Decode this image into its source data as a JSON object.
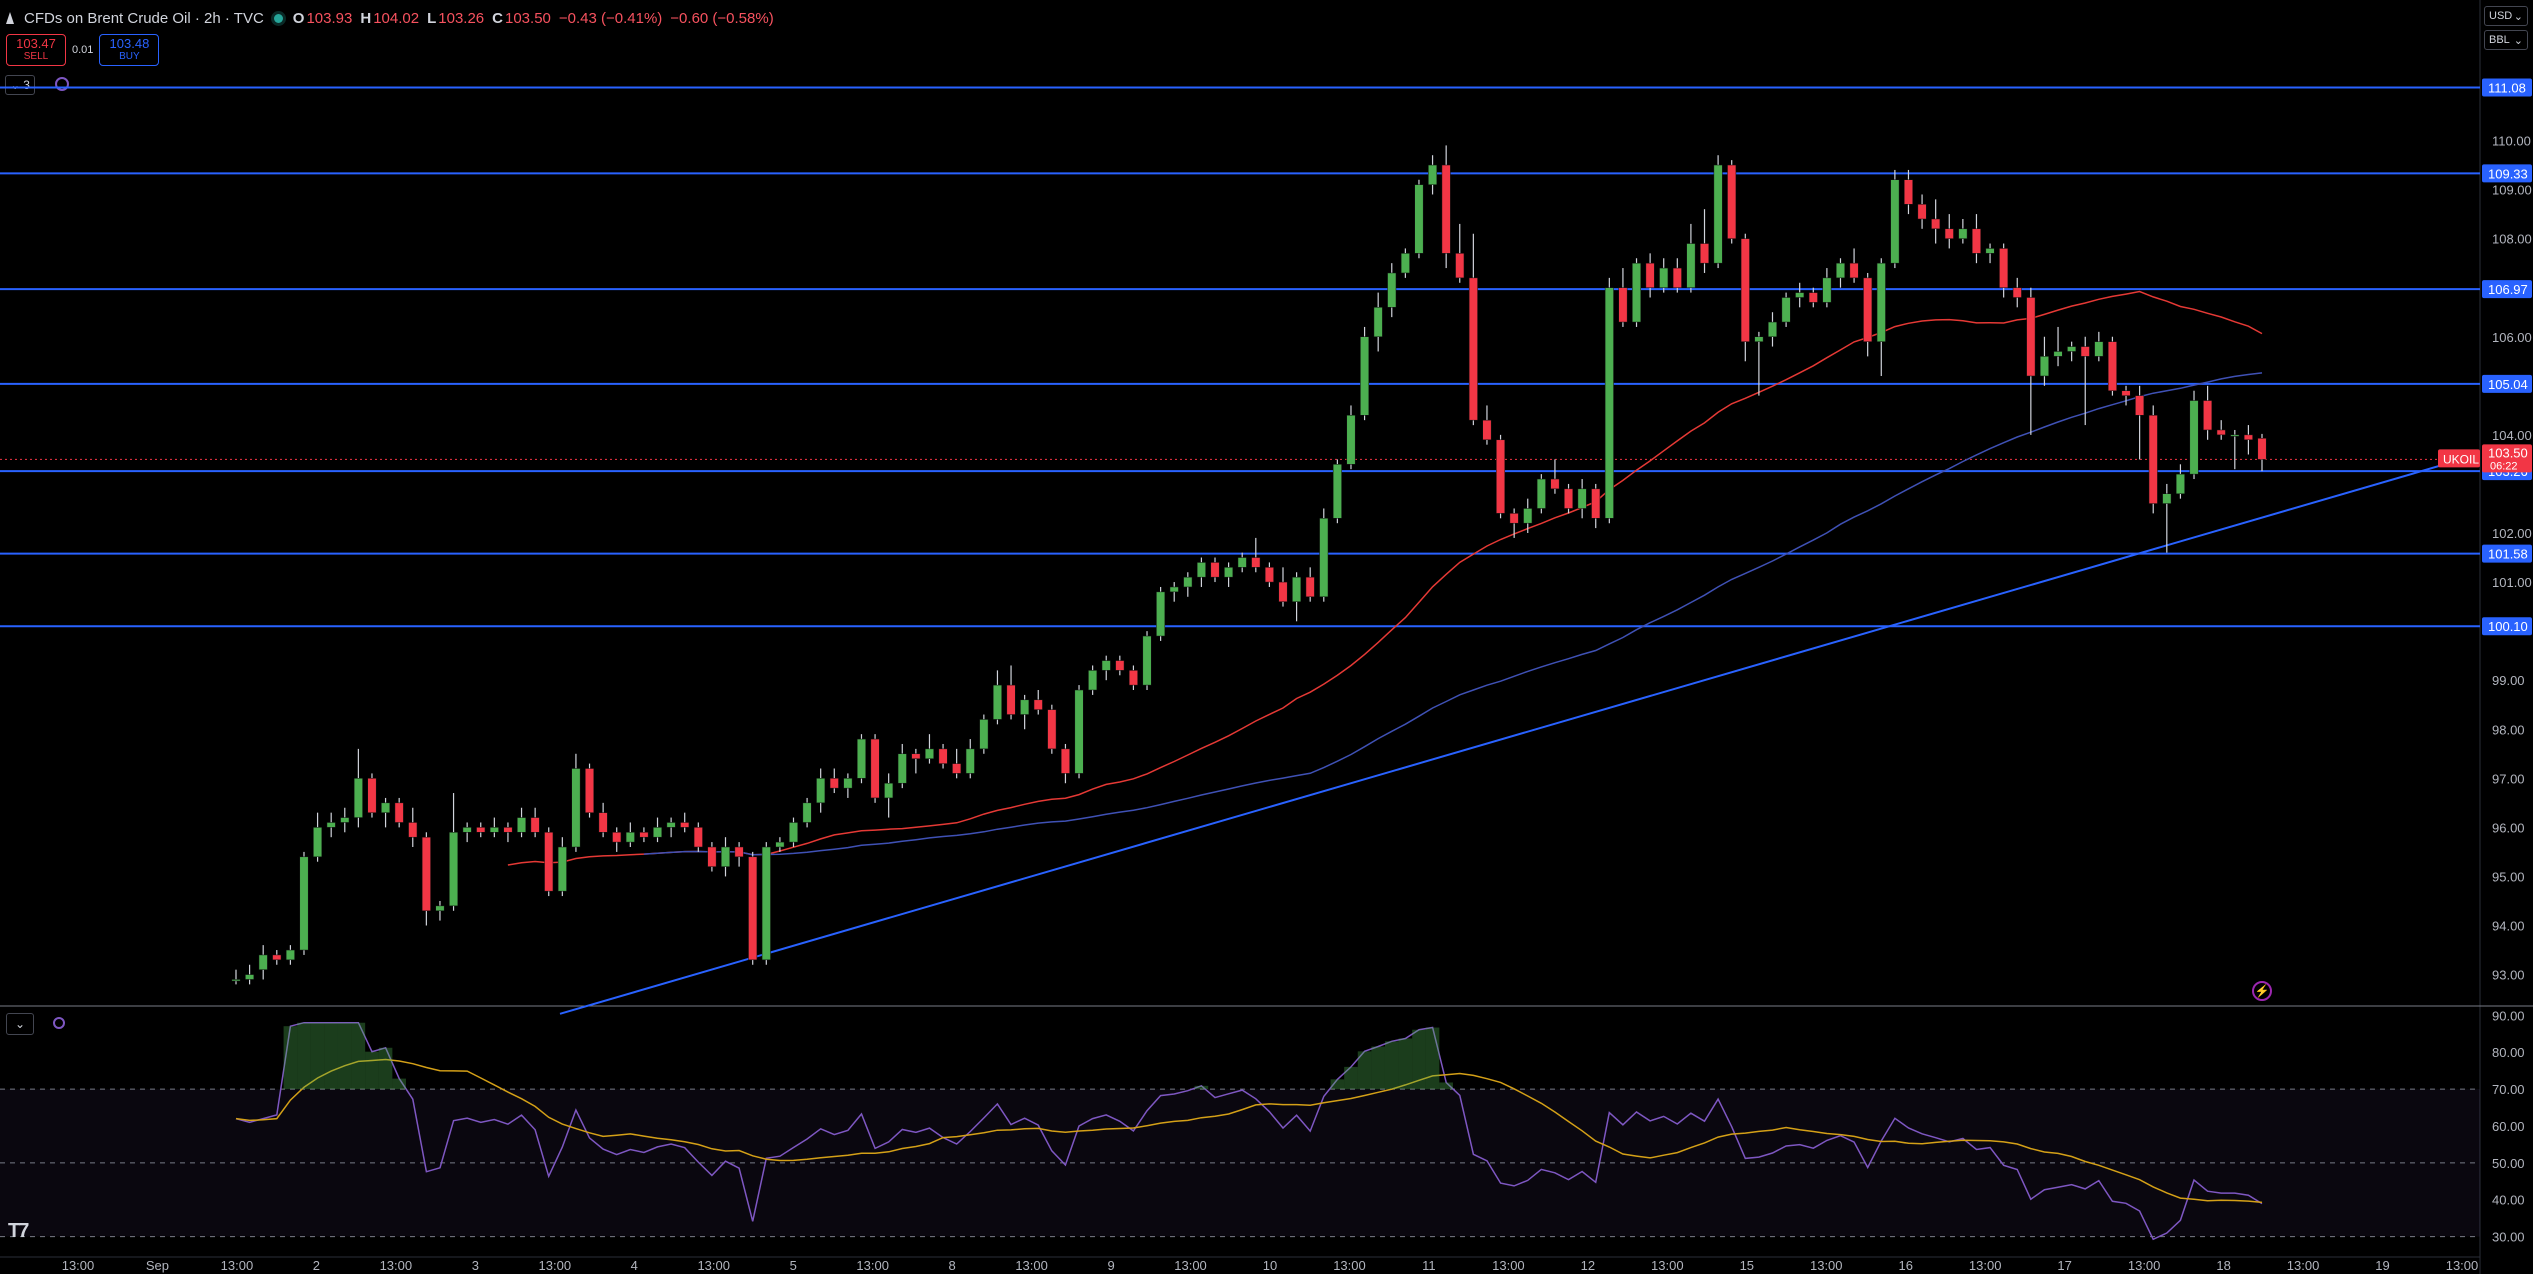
{
  "header": {
    "title": "CFDs on Brent Crude Oil · 2h · TVC",
    "ohlc": [
      {
        "key": "O",
        "value": "103.93"
      },
      {
        "key": "H",
        "value": "104.02"
      },
      {
        "key": "L",
        "value": "103.26"
      },
      {
        "key": "C",
        "value": "103.50"
      }
    ],
    "change": "−0.43 (−0.41%)",
    "change2": "−0.60 (−0.58%)"
  },
  "trade": {
    "sell_price": "103.47",
    "sell_label": "SELL",
    "spread": "0.01",
    "buy_price": "103.48",
    "buy_label": "BUY"
  },
  "indicators_count": "3",
  "units": {
    "currency": "USD",
    "unit": "BBL"
  },
  "colors": {
    "up": "#26a69a",
    "up_body": "#4caf50",
    "down": "#f23645",
    "hline": "#2962ff",
    "ma_red": "#e53935",
    "ma_blue": "#3f51b5",
    "rsi": "#7e57c2",
    "rsi_ma": "#d4a017"
  },
  "price_axis": {
    "ticks": [
      "110.00",
      "109.00",
      "108.00",
      "106.00",
      "104.00",
      "102.00",
      "101.00",
      "99.00",
      "98.00",
      "97.00",
      "96.00",
      "95.00",
      "94.00",
      "93.00"
    ],
    "level_labels": [
      "111.08",
      "109.33",
      "106.97",
      "105.04",
      "103.26",
      "101.58",
      "100.10"
    ],
    "symbol_tag": "UKOIL",
    "last_price": "103.50",
    "countdown": "06:22"
  },
  "rsi_axis": {
    "ticks": [
      "90.00",
      "80.00",
      "70.00",
      "60.00",
      "50.00",
      "40.00",
      "30.00"
    ]
  },
  "time_axis": {
    "labels": [
      "13:00",
      "Sep",
      "13:00",
      "2",
      "13:00",
      "3",
      "13:00",
      "4",
      "13:00",
      "5",
      "13:00",
      "8",
      "13:00",
      "9",
      "13:00",
      "10",
      "13:00",
      "11",
      "13:00",
      "12",
      "13:00",
      "15",
      "13:00",
      "16",
      "13:00",
      "17",
      "13:00",
      "18",
      "13:00",
      "19",
      "13:00"
    ]
  },
  "chart_data": {
    "type": "candlestick",
    "title": "CFDs on Brent Crude Oil · 2h · TVC",
    "ylim": [
      92.4,
      111.6
    ],
    "horizontal_levels": [
      111.08,
      109.33,
      106.97,
      105.04,
      103.26,
      101.58,
      100.1
    ],
    "candles": [
      {
        "o": 92.9,
        "h": 93.1,
        "l": 92.8,
        "c": 92.9
      },
      {
        "o": 92.9,
        "h": 93.2,
        "l": 92.8,
        "c": 93.0
      },
      {
        "o": 93.1,
        "h": 93.6,
        "l": 92.9,
        "c": 93.4
      },
      {
        "o": 93.4,
        "h": 93.5,
        "l": 93.2,
        "c": 93.3
      },
      {
        "o": 93.3,
        "h": 93.6,
        "l": 93.2,
        "c": 93.5
      },
      {
        "o": 93.5,
        "h": 95.5,
        "l": 93.4,
        "c": 95.4
      },
      {
        "o": 95.4,
        "h": 96.3,
        "l": 95.3,
        "c": 96.0
      },
      {
        "o": 96.0,
        "h": 96.3,
        "l": 95.8,
        "c": 96.1
      },
      {
        "o": 96.1,
        "h": 96.4,
        "l": 95.9,
        "c": 96.2
      },
      {
        "o": 96.2,
        "h": 97.6,
        "l": 96.0,
        "c": 97.0
      },
      {
        "o": 97.0,
        "h": 97.1,
        "l": 96.2,
        "c": 96.3
      },
      {
        "o": 96.3,
        "h": 96.6,
        "l": 96.0,
        "c": 96.5
      },
      {
        "o": 96.5,
        "h": 96.6,
        "l": 96.0,
        "c": 96.1
      },
      {
        "o": 96.1,
        "h": 96.4,
        "l": 95.6,
        "c": 95.8
      },
      {
        "o": 95.8,
        "h": 95.9,
        "l": 94.0,
        "c": 94.3
      },
      {
        "o": 94.3,
        "h": 94.5,
        "l": 94.1,
        "c": 94.4
      },
      {
        "o": 94.4,
        "h": 96.7,
        "l": 94.3,
        "c": 95.9
      },
      {
        "o": 95.9,
        "h": 96.1,
        "l": 95.7,
        "c": 96.0
      },
      {
        "o": 96.0,
        "h": 96.1,
        "l": 95.8,
        "c": 95.9
      },
      {
        "o": 95.9,
        "h": 96.2,
        "l": 95.8,
        "c": 96.0
      },
      {
        "o": 96.0,
        "h": 96.1,
        "l": 95.7,
        "c": 95.9
      },
      {
        "o": 95.9,
        "h": 96.4,
        "l": 95.8,
        "c": 96.2
      },
      {
        "o": 96.2,
        "h": 96.4,
        "l": 95.8,
        "c": 95.9
      },
      {
        "o": 95.9,
        "h": 96.0,
        "l": 94.6,
        "c": 94.7
      },
      {
        "o": 94.7,
        "h": 95.8,
        "l": 94.6,
        "c": 95.6
      },
      {
        "o": 95.6,
        "h": 97.5,
        "l": 95.5,
        "c": 97.2
      },
      {
        "o": 97.2,
        "h": 97.3,
        "l": 96.2,
        "c": 96.3
      },
      {
        "o": 96.3,
        "h": 96.5,
        "l": 95.8,
        "c": 95.9
      },
      {
        "o": 95.9,
        "h": 96.0,
        "l": 95.5,
        "c": 95.7
      },
      {
        "o": 95.7,
        "h": 96.1,
        "l": 95.6,
        "c": 95.9
      },
      {
        "o": 95.9,
        "h": 96.0,
        "l": 95.7,
        "c": 95.8
      },
      {
        "o": 95.8,
        "h": 96.2,
        "l": 95.7,
        "c": 96.0
      },
      {
        "o": 96.0,
        "h": 96.2,
        "l": 95.8,
        "c": 96.1
      },
      {
        "o": 96.1,
        "h": 96.3,
        "l": 95.9,
        "c": 96.0
      },
      {
        "o": 96.0,
        "h": 96.1,
        "l": 95.5,
        "c": 95.6
      },
      {
        "o": 95.6,
        "h": 95.7,
        "l": 95.1,
        "c": 95.2
      },
      {
        "o": 95.2,
        "h": 95.8,
        "l": 95.0,
        "c": 95.6
      },
      {
        "o": 95.6,
        "h": 95.7,
        "l": 95.2,
        "c": 95.4
      },
      {
        "o": 95.4,
        "h": 95.5,
        "l": 93.2,
        "c": 93.3
      },
      {
        "o": 93.3,
        "h": 95.7,
        "l": 93.2,
        "c": 95.6
      },
      {
        "o": 95.6,
        "h": 95.8,
        "l": 95.5,
        "c": 95.7
      },
      {
        "o": 95.7,
        "h": 96.2,
        "l": 95.6,
        "c": 96.1
      },
      {
        "o": 96.1,
        "h": 96.6,
        "l": 96.0,
        "c": 96.5
      },
      {
        "o": 96.5,
        "h": 97.2,
        "l": 96.3,
        "c": 97.0
      },
      {
        "o": 97.0,
        "h": 97.2,
        "l": 96.7,
        "c": 96.8
      },
      {
        "o": 96.8,
        "h": 97.1,
        "l": 96.6,
        "c": 97.0
      },
      {
        "o": 97.0,
        "h": 97.9,
        "l": 96.9,
        "c": 97.8
      },
      {
        "o": 97.8,
        "h": 97.9,
        "l": 96.5,
        "c": 96.6
      },
      {
        "o": 96.6,
        "h": 97.1,
        "l": 96.2,
        "c": 96.9
      },
      {
        "o": 96.9,
        "h": 97.7,
        "l": 96.8,
        "c": 97.5
      },
      {
        "o": 97.5,
        "h": 97.6,
        "l": 97.1,
        "c": 97.4
      },
      {
        "o": 97.4,
        "h": 97.9,
        "l": 97.3,
        "c": 97.6
      },
      {
        "o": 97.6,
        "h": 97.7,
        "l": 97.2,
        "c": 97.3
      },
      {
        "o": 97.3,
        "h": 97.6,
        "l": 97.0,
        "c": 97.1
      },
      {
        "o": 97.1,
        "h": 97.8,
        "l": 97.0,
        "c": 97.6
      },
      {
        "o": 97.6,
        "h": 98.3,
        "l": 97.5,
        "c": 98.2
      },
      {
        "o": 98.2,
        "h": 99.2,
        "l": 98.1,
        "c": 98.9
      },
      {
        "o": 98.9,
        "h": 99.3,
        "l": 98.2,
        "c": 98.3
      },
      {
        "o": 98.3,
        "h": 98.7,
        "l": 98.0,
        "c": 98.6
      },
      {
        "o": 98.6,
        "h": 98.8,
        "l": 98.3,
        "c": 98.4
      },
      {
        "o": 98.4,
        "h": 98.5,
        "l": 97.5,
        "c": 97.6
      },
      {
        "o": 97.6,
        "h": 97.7,
        "l": 96.9,
        "c": 97.1
      },
      {
        "o": 97.1,
        "h": 98.9,
        "l": 97.0,
        "c": 98.8
      },
      {
        "o": 98.8,
        "h": 99.3,
        "l": 98.7,
        "c": 99.2
      },
      {
        "o": 99.2,
        "h": 99.5,
        "l": 99.0,
        "c": 99.4
      },
      {
        "o": 99.4,
        "h": 99.5,
        "l": 99.1,
        "c": 99.2
      },
      {
        "o": 99.2,
        "h": 99.3,
        "l": 98.8,
        "c": 98.9
      },
      {
        "o": 98.9,
        "h": 100.0,
        "l": 98.8,
        "c": 99.9
      },
      {
        "o": 99.9,
        "h": 100.9,
        "l": 99.8,
        "c": 100.8
      },
      {
        "o": 100.8,
        "h": 101.0,
        "l": 100.6,
        "c": 100.9
      },
      {
        "o": 100.9,
        "h": 101.2,
        "l": 100.7,
        "c": 101.1
      },
      {
        "o": 101.1,
        "h": 101.5,
        "l": 100.9,
        "c": 101.4
      },
      {
        "o": 101.4,
        "h": 101.5,
        "l": 101.0,
        "c": 101.1
      },
      {
        "o": 101.1,
        "h": 101.4,
        "l": 100.9,
        "c": 101.3
      },
      {
        "o": 101.3,
        "h": 101.6,
        "l": 101.2,
        "c": 101.5
      },
      {
        "o": 101.5,
        "h": 101.9,
        "l": 101.2,
        "c": 101.3
      },
      {
        "o": 101.3,
        "h": 101.4,
        "l": 100.9,
        "c": 101.0
      },
      {
        "o": 101.0,
        "h": 101.3,
        "l": 100.5,
        "c": 100.6
      },
      {
        "o": 100.6,
        "h": 101.2,
        "l": 100.2,
        "c": 101.1
      },
      {
        "o": 101.1,
        "h": 101.3,
        "l": 100.6,
        "c": 100.7
      },
      {
        "o": 100.7,
        "h": 102.5,
        "l": 100.6,
        "c": 102.3
      },
      {
        "o": 102.3,
        "h": 103.5,
        "l": 102.2,
        "c": 103.4
      },
      {
        "o": 103.4,
        "h": 104.6,
        "l": 103.3,
        "c": 104.4
      },
      {
        "o": 104.4,
        "h": 106.2,
        "l": 104.3,
        "c": 106.0
      },
      {
        "o": 106.0,
        "h": 106.9,
        "l": 105.7,
        "c": 106.6
      },
      {
        "o": 106.6,
        "h": 107.5,
        "l": 106.4,
        "c": 107.3
      },
      {
        "o": 107.3,
        "h": 107.8,
        "l": 107.2,
        "c": 107.7
      },
      {
        "o": 107.7,
        "h": 109.2,
        "l": 107.6,
        "c": 109.1
      },
      {
        "o": 109.1,
        "h": 109.7,
        "l": 108.9,
        "c": 109.5
      },
      {
        "o": 109.5,
        "h": 109.9,
        "l": 107.4,
        "c": 107.7
      },
      {
        "o": 107.7,
        "h": 108.3,
        "l": 107.1,
        "c": 107.2
      },
      {
        "o": 107.2,
        "h": 108.1,
        "l": 104.2,
        "c": 104.3
      },
      {
        "o": 104.3,
        "h": 104.6,
        "l": 103.8,
        "c": 103.9
      },
      {
        "o": 103.9,
        "h": 104.0,
        "l": 102.3,
        "c": 102.4
      },
      {
        "o": 102.4,
        "h": 102.5,
        "l": 101.9,
        "c": 102.2
      },
      {
        "o": 102.2,
        "h": 102.7,
        "l": 102.0,
        "c": 102.5
      },
      {
        "o": 102.5,
        "h": 103.2,
        "l": 102.4,
        "c": 103.1
      },
      {
        "o": 103.1,
        "h": 103.5,
        "l": 102.8,
        "c": 102.9
      },
      {
        "o": 102.9,
        "h": 103.0,
        "l": 102.4,
        "c": 102.5
      },
      {
        "o": 102.5,
        "h": 103.1,
        "l": 102.3,
        "c": 102.9
      },
      {
        "o": 102.9,
        "h": 103.0,
        "l": 102.1,
        "c": 102.3
      },
      {
        "o": 102.3,
        "h": 107.2,
        "l": 102.2,
        "c": 107.0
      },
      {
        "o": 107.0,
        "h": 107.4,
        "l": 106.2,
        "c": 106.3
      },
      {
        "o": 106.3,
        "h": 107.6,
        "l": 106.2,
        "c": 107.5
      },
      {
        "o": 107.5,
        "h": 107.7,
        "l": 106.8,
        "c": 107.0
      },
      {
        "o": 107.0,
        "h": 107.6,
        "l": 106.9,
        "c": 107.4
      },
      {
        "o": 107.4,
        "h": 107.6,
        "l": 106.9,
        "c": 107.0
      },
      {
        "o": 107.0,
        "h": 108.3,
        "l": 106.9,
        "c": 107.9
      },
      {
        "o": 107.9,
        "h": 108.6,
        "l": 107.3,
        "c": 107.5
      },
      {
        "o": 107.5,
        "h": 109.7,
        "l": 107.4,
        "c": 109.5
      },
      {
        "o": 109.5,
        "h": 109.6,
        "l": 107.9,
        "c": 108.0
      },
      {
        "o": 108.0,
        "h": 108.1,
        "l": 105.5,
        "c": 105.9
      },
      {
        "o": 105.9,
        "h": 106.1,
        "l": 104.8,
        "c": 106.0
      },
      {
        "o": 106.0,
        "h": 106.5,
        "l": 105.8,
        "c": 106.3
      },
      {
        "o": 106.3,
        "h": 106.9,
        "l": 106.2,
        "c": 106.8
      },
      {
        "o": 106.8,
        "h": 107.1,
        "l": 106.6,
        "c": 106.9
      },
      {
        "o": 106.9,
        "h": 107.0,
        "l": 106.6,
        "c": 106.7
      },
      {
        "o": 106.7,
        "h": 107.4,
        "l": 106.6,
        "c": 107.2
      },
      {
        "o": 107.2,
        "h": 107.6,
        "l": 107.0,
        "c": 107.5
      },
      {
        "o": 107.5,
        "h": 107.8,
        "l": 107.1,
        "c": 107.2
      },
      {
        "o": 107.2,
        "h": 107.3,
        "l": 105.6,
        "c": 105.9
      },
      {
        "o": 105.9,
        "h": 107.6,
        "l": 105.2,
        "c": 107.5
      },
      {
        "o": 107.5,
        "h": 109.4,
        "l": 107.4,
        "c": 109.2
      },
      {
        "o": 109.2,
        "h": 109.4,
        "l": 108.5,
        "c": 108.7
      },
      {
        "o": 108.7,
        "h": 108.9,
        "l": 108.2,
        "c": 108.4
      },
      {
        "o": 108.4,
        "h": 108.8,
        "l": 107.9,
        "c": 108.2
      },
      {
        "o": 108.2,
        "h": 108.5,
        "l": 107.8,
        "c": 108.0
      },
      {
        "o": 108.0,
        "h": 108.4,
        "l": 107.9,
        "c": 108.2
      },
      {
        "o": 108.2,
        "h": 108.5,
        "l": 107.5,
        "c": 107.7
      },
      {
        "o": 107.7,
        "h": 107.9,
        "l": 107.5,
        "c": 107.8
      },
      {
        "o": 107.8,
        "h": 107.9,
        "l": 106.8,
        "c": 107.0
      },
      {
        "o": 107.0,
        "h": 107.2,
        "l": 106.6,
        "c": 106.8
      },
      {
        "o": 106.8,
        "h": 107.0,
        "l": 104.0,
        "c": 105.2
      },
      {
        "o": 105.2,
        "h": 106.0,
        "l": 105.0,
        "c": 105.6
      },
      {
        "o": 105.6,
        "h": 106.2,
        "l": 105.4,
        "c": 105.7
      },
      {
        "o": 105.7,
        "h": 105.9,
        "l": 105.5,
        "c": 105.8
      },
      {
        "o": 105.8,
        "h": 106.0,
        "l": 104.2,
        "c": 105.6
      },
      {
        "o": 105.6,
        "h": 106.1,
        "l": 105.5,
        "c": 105.9
      },
      {
        "o": 105.9,
        "h": 106.0,
        "l": 104.8,
        "c": 104.9
      },
      {
        "o": 104.9,
        "h": 105.0,
        "l": 104.6,
        "c": 104.8
      },
      {
        "o": 104.8,
        "h": 105.0,
        "l": 103.5,
        "c": 104.4
      },
      {
        "o": 104.4,
        "h": 104.6,
        "l": 102.4,
        "c": 102.6
      },
      {
        "o": 102.6,
        "h": 103.0,
        "l": 101.6,
        "c": 102.8
      },
      {
        "o": 102.8,
        "h": 103.4,
        "l": 102.7,
        "c": 103.2
      },
      {
        "o": 103.2,
        "h": 104.9,
        "l": 103.1,
        "c": 104.7
      },
      {
        "o": 104.7,
        "h": 105.0,
        "l": 103.9,
        "c": 104.1
      },
      {
        "o": 104.1,
        "h": 104.3,
        "l": 103.9,
        "c": 104.0
      },
      {
        "o": 104.0,
        "h": 104.1,
        "l": 103.3,
        "c": 104.0
      },
      {
        "o": 104.0,
        "h": 104.2,
        "l": 103.6,
        "c": 103.9
      },
      {
        "o": 103.93,
        "h": 104.02,
        "l": 103.26,
        "c": 103.5
      }
    ],
    "rsi_ylim": [
      25,
      92
    ],
    "rsi_levels": [
      70,
      50,
      30
    ]
  }
}
